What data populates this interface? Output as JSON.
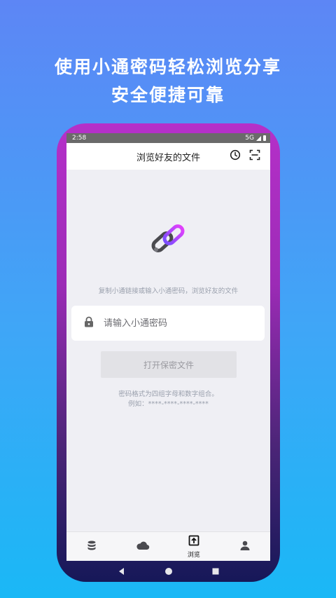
{
  "promo": {
    "line1": "使用小通密码轻松浏览分享",
    "line2": "安全便捷可靠"
  },
  "status": {
    "time": "2:58",
    "network": "5G"
  },
  "appbar": {
    "title": "浏览好友的文件",
    "history_icon": "clock-icon",
    "scan_icon": "scan-icon"
  },
  "main": {
    "logo_icon": "paperclip-link-icon",
    "hint": "复制小通链接或输入小通密码，浏览好友的文件",
    "password_placeholder": "请输入小通密码",
    "open_button": "打开保密文件",
    "format_note": "密码格式为四组字母和数字组合。",
    "example_note": "例如：****-****-****-****"
  },
  "tabs": [
    {
      "icon": "database-icon",
      "label": ""
    },
    {
      "icon": "cloud-icon",
      "label": ""
    },
    {
      "icon": "browse-upload-icon",
      "label": "浏览"
    },
    {
      "icon": "person-icon",
      "label": ""
    }
  ],
  "colors": {
    "accent_pink": "#e040fb",
    "accent_purple": "#7c4dff",
    "background": "#efeff4"
  }
}
